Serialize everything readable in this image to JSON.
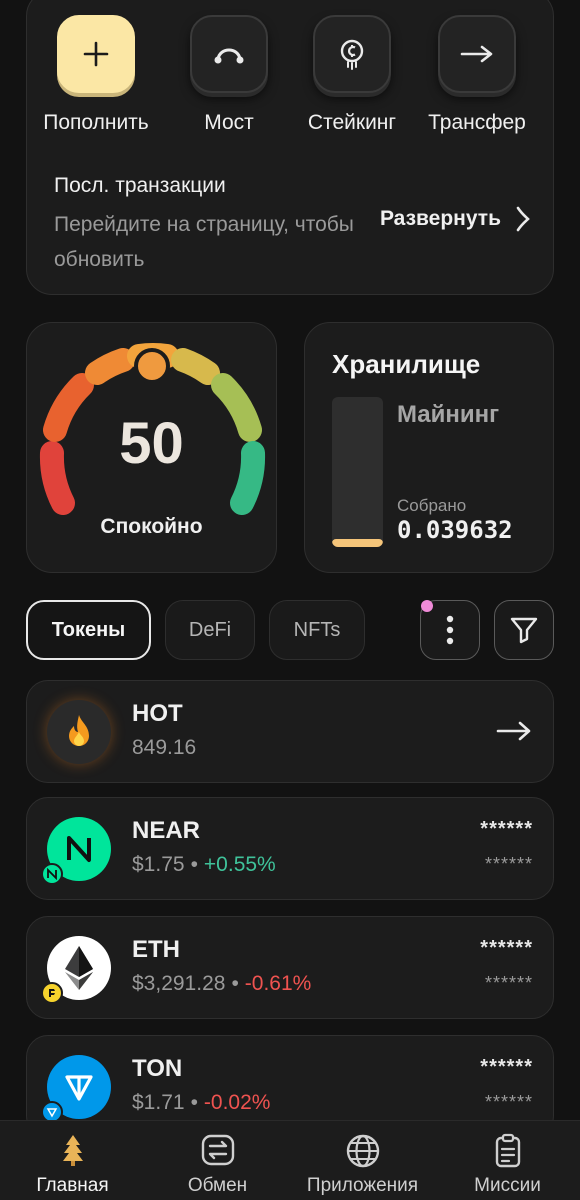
{
  "actions": [
    {
      "label": "Пополнить",
      "icon": "plus-icon"
    },
    {
      "label": "Мост",
      "icon": "bridge-icon"
    },
    {
      "label": "Стейкинг",
      "icon": "staking-icon"
    },
    {
      "label": "Трансфер",
      "icon": "arrow-right-icon"
    }
  ],
  "transactions": {
    "title": "Посл. транзакции",
    "description": "Перейдите на страницу, чтобы обновить",
    "expand_label": "Развернуть"
  },
  "gauge": {
    "value": "50",
    "label": "Спокойно",
    "level": 0.5
  },
  "storage": {
    "title": "Хранилище",
    "mining_label": "Майнинг",
    "collected_label": "Собрано",
    "collected_value": "0.039632",
    "fill_fraction": 0.05
  },
  "tabs": [
    "Токены",
    "DeFi",
    "NFTs"
  ],
  "tokens": [
    {
      "symbol": "HOT",
      "balance": "849.16"
    },
    {
      "symbol": "NEAR",
      "price": "$1.75",
      "change": "+0.55%",
      "hidden_value": "******",
      "hidden_amount": "******"
    },
    {
      "symbol": "ETH",
      "price": "$3,291.28",
      "change": "-0.61%",
      "hidden_value": "******",
      "hidden_amount": "******"
    },
    {
      "symbol": "TON",
      "price": "$1.71",
      "change": "-0.02%",
      "hidden_value": "******",
      "hidden_amount": "******"
    }
  ],
  "nav": [
    "Главная",
    "Обмен",
    "Приложения",
    "Миссии"
  ],
  "colors": {
    "accent": "#fbe7a5",
    "positive": "#3fc29a",
    "negative": "#ef5350",
    "badge": "#f08bd8"
  }
}
